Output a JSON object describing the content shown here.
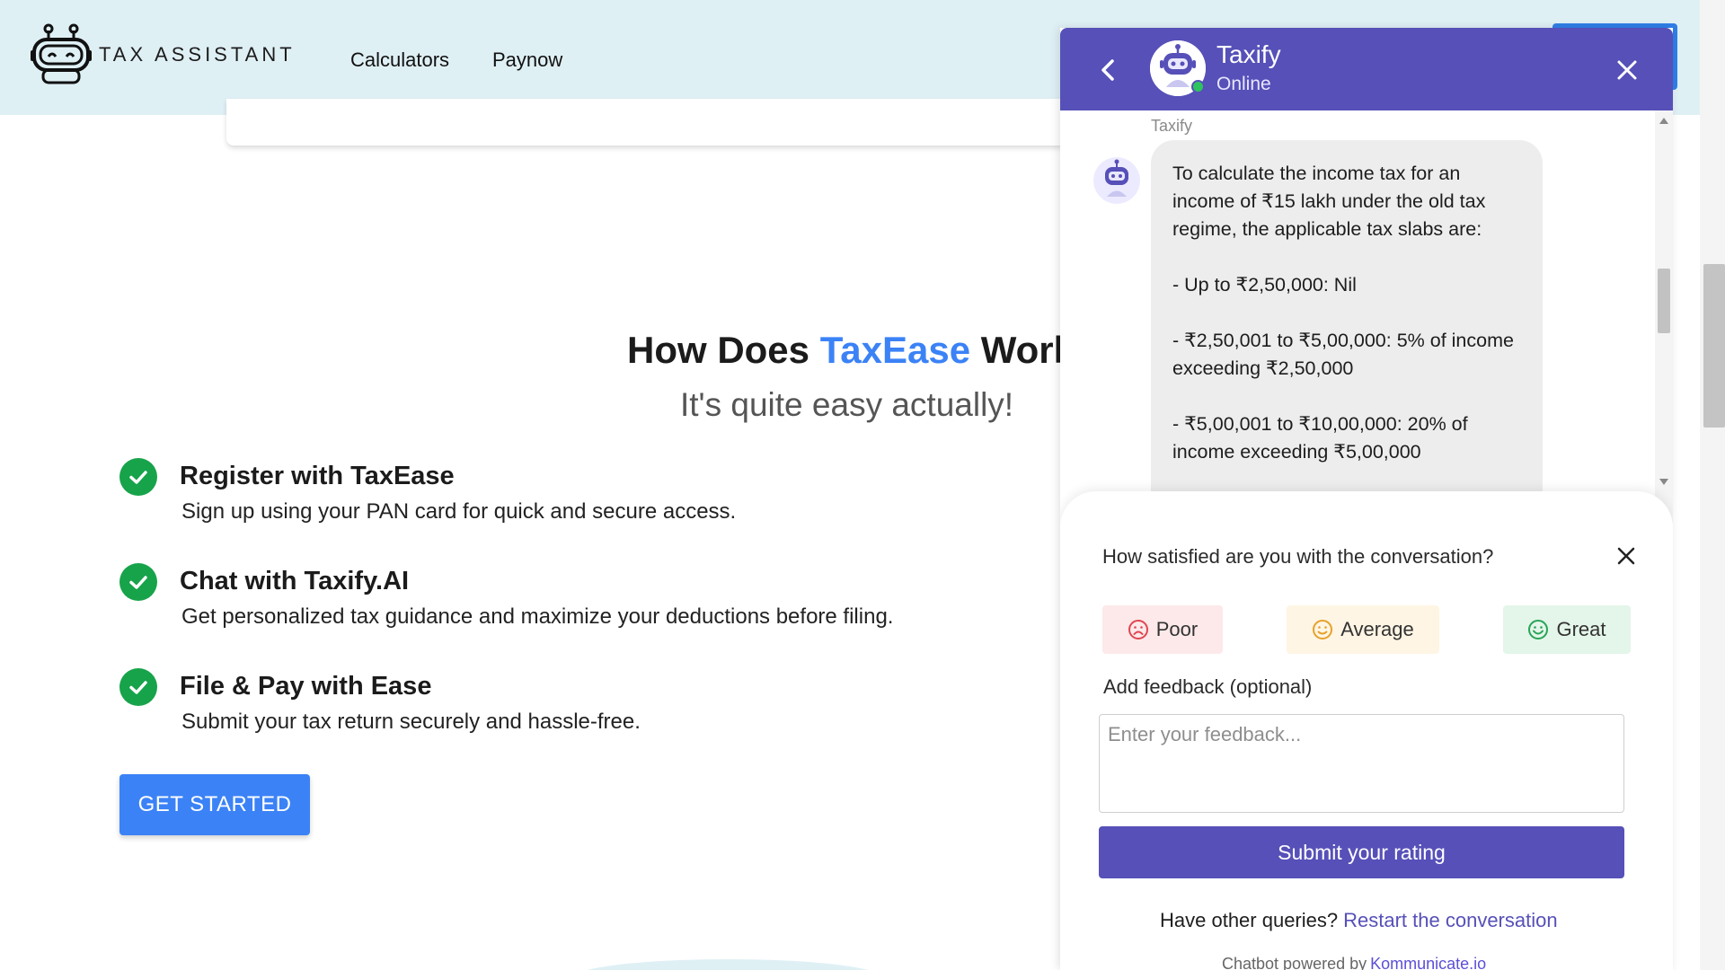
{
  "header": {
    "brand": "TAX ASSISTANT",
    "nav": [
      "Calculators",
      "Paynow"
    ]
  },
  "hero": {
    "title_prefix": "How Does ",
    "title_highlight": "TaxEase",
    "title_suffix": " Work'",
    "subtitle": "It's quite easy actually!"
  },
  "steps": [
    {
      "title": "Register with TaxEase",
      "desc": "Sign up using your PAN card for quick and secure access."
    },
    {
      "title": "Chat with Taxify.AI",
      "desc": "Get personalized tax guidance and maximize your deductions before filing."
    },
    {
      "title": "File & Pay with Ease",
      "desc": "Submit your tax return securely and hassle-free."
    }
  ],
  "cta": {
    "label": "GET STARTED"
  },
  "chat": {
    "name": "Taxify",
    "status": "Online",
    "sender": "Taxify",
    "message": "To calculate the income tax for an income of ₹15 lakh under the old tax regime, the applicable tax slabs are:\n\n- Up to ₹2,50,000: Nil\n\n- ₹2,50,001 to ₹5,00,000: 5% of income exceeding ₹2,50,000\n\n- ₹5,00,001 to ₹10,00,000: 20% of income exceeding ₹5,00,000"
  },
  "feedback": {
    "question": "How satisfied are you with the conversation?",
    "ratings": [
      "Poor",
      "Average",
      "Great"
    ],
    "label": "Add feedback (optional)",
    "placeholder": "Enter your feedback...",
    "submit": "Submit your rating",
    "other_queries": "Have other queries?",
    "restart": "Restart the conversation",
    "powered_by": "Chatbot powered by",
    "powered_link": "Kommunicate.io"
  },
  "colors": {
    "header_bg": "#dff0f5",
    "accent_blue": "#3b82f6",
    "chat_purple": "#5650b8",
    "check_green": "#17a34a",
    "online_green": "#2fc35f"
  },
  "icons": [
    "robot-logo-icon",
    "back-arrow-icon",
    "close-icon",
    "check-icon",
    "sad-face-icon",
    "neutral-face-icon",
    "smile-face-icon"
  ]
}
